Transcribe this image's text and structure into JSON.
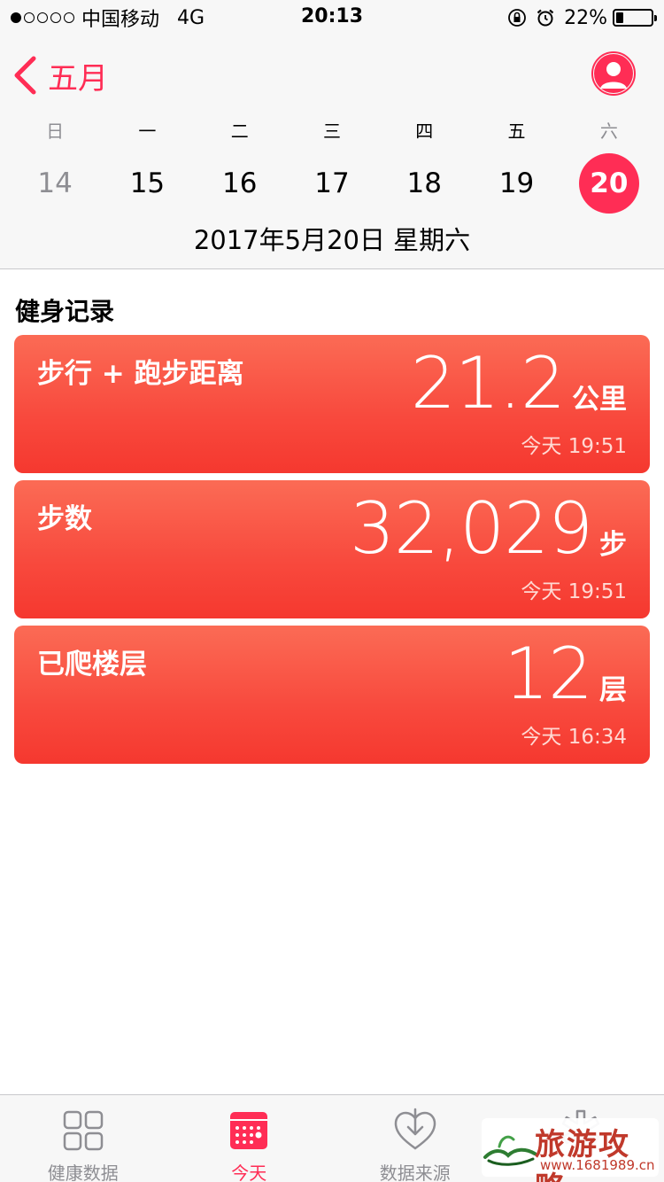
{
  "status_bar": {
    "signal_dots": [
      1,
      0,
      0,
      0,
      0
    ],
    "carrier": "中国移动",
    "network": "4G",
    "time": "20:13",
    "battery_text": "22%",
    "battery_level": 0.22
  },
  "header": {
    "back_label": "五月",
    "weekdays": [
      "日",
      "一",
      "二",
      "三",
      "四",
      "五",
      "六"
    ],
    "days": [
      "14",
      "15",
      "16",
      "17",
      "18",
      "19",
      "20"
    ],
    "selected_day": "20",
    "date_text": "2017年5月20日 星期六"
  },
  "section": {
    "title": "健身记录"
  },
  "cards": [
    {
      "label": "步行 + 跑步距离",
      "value": "21.2",
      "unit": "公里",
      "time": "今天 19:51"
    },
    {
      "label": "步数",
      "value": "32,029",
      "unit": "步",
      "time": "今天 19:51"
    },
    {
      "label": "已爬楼层",
      "value": "12",
      "unit": "层",
      "time": "今天 16:34"
    }
  ],
  "tab_bar": {
    "tabs": [
      {
        "label": "健康数据",
        "icon": "grid-icon"
      },
      {
        "label": "今天",
        "icon": "calendar-icon"
      },
      {
        "label": "数据来源",
        "icon": "heart-download-icon"
      },
      {
        "label": "",
        "icon": "medical-id-icon"
      }
    ],
    "active_index": 1
  },
  "watermark": {
    "title": "旅游攻略",
    "url": "www.1681989.cn"
  },
  "colors": {
    "accent": "#ff2d55",
    "card_top": "#fb6b55",
    "card_bottom": "#f5382f",
    "muted": "#8e8e93"
  }
}
